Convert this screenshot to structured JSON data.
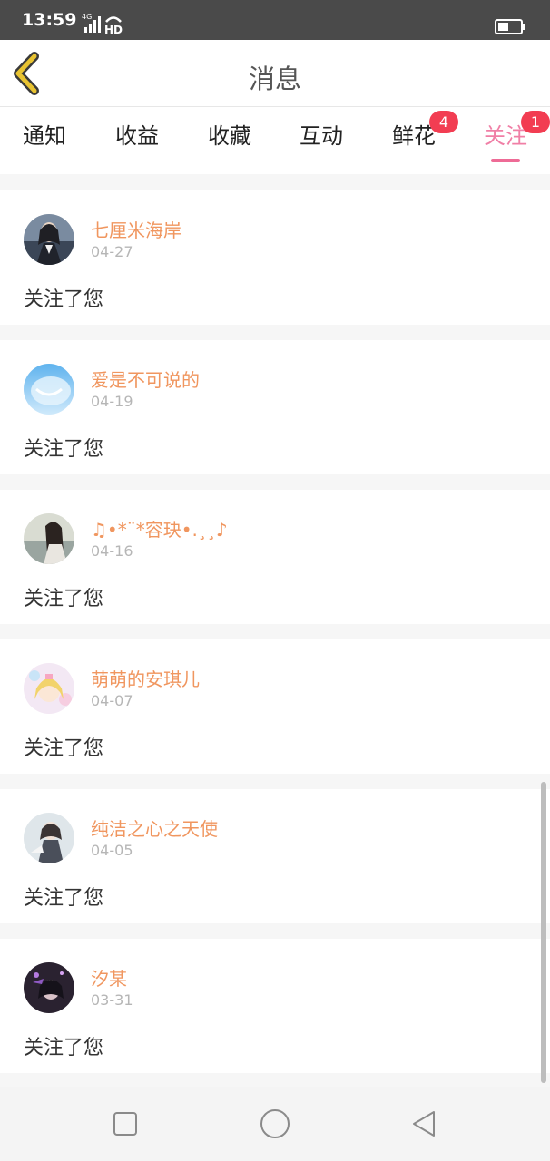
{
  "status_bar": {
    "time": "13:59",
    "network": "4G",
    "hd": "HD"
  },
  "header": {
    "title": "消息",
    "back_icon": "chevron-left-icon"
  },
  "tabs": [
    {
      "label": "通知"
    },
    {
      "label": "收益"
    },
    {
      "label": "收藏"
    },
    {
      "label": "互动"
    },
    {
      "label": "鲜花",
      "badge": "4"
    },
    {
      "label": "关注",
      "badge": "1",
      "active": true
    }
  ],
  "messages": [
    {
      "name": "七厘米海岸",
      "date": "04-27",
      "text": "关注了您"
    },
    {
      "name": "爱是不可说的",
      "date": "04-19",
      "text": "关注了您"
    },
    {
      "name": "♫•*¨*容玦•.¸¸♪",
      "date": "04-16",
      "text": "关注了您"
    },
    {
      "name": "萌萌的安琪儿",
      "date": "04-07",
      "text": "关注了您"
    },
    {
      "name": "纯洁之心之天使",
      "date": "04-05",
      "text": "关注了您"
    },
    {
      "name": "汐某",
      "date": "03-31",
      "text": "关注了您"
    }
  ],
  "colors": {
    "accent": "#ee6b96",
    "username": "#f0965f",
    "badge": "#f23d52",
    "back_icon": "#e8c331"
  },
  "system_nav": {
    "icons": [
      "square-icon",
      "circle-icon",
      "triangle-back-icon"
    ]
  }
}
